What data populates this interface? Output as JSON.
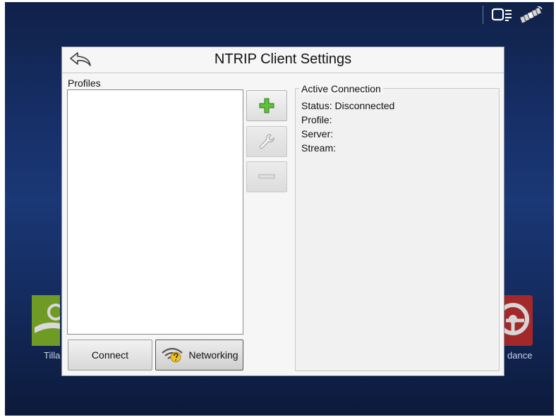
{
  "dialog": {
    "title": "NTRIP Client Settings",
    "profiles_label": "Profiles",
    "profiles": [],
    "active_connection": {
      "legend": "Active Connection",
      "status": "Status: Disconnected",
      "profile": "Profile:",
      "server": "Server:",
      "stream": "Stream:"
    },
    "buttons": {
      "connect": "Connect",
      "networking": "Networking"
    }
  },
  "background": {
    "left_app_label": "Tilla",
    "right_app_label": "dance"
  },
  "colors": {
    "accent_green": "#4caf2a",
    "background_navy": "#17306a",
    "tile_green": "#6f9a26",
    "tile_red": "#a3282a"
  },
  "icons": [
    "back-arrow-icon",
    "add-icon",
    "wrench-icon",
    "minus-icon",
    "wifi-question-icon",
    "display-icon",
    "satellite-icon"
  ]
}
